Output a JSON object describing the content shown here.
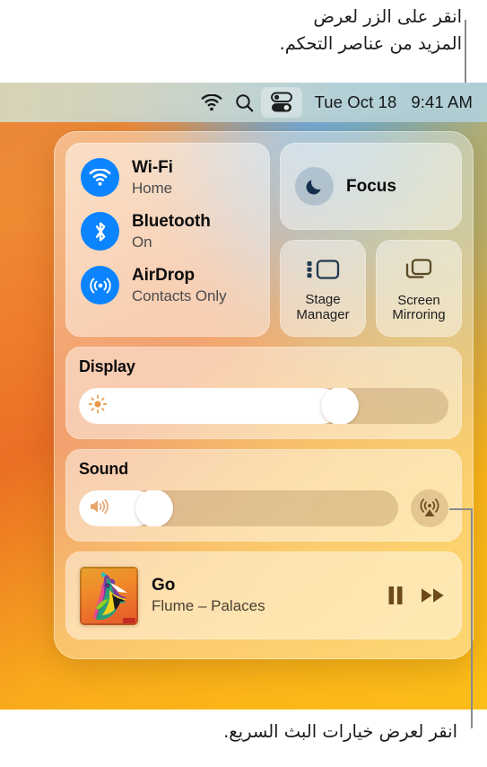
{
  "annotations": {
    "top": "انقر على الزر لعرض\nالمزيد من عناصر التحكم.",
    "bottom": "انقر لعرض خيارات البث السريع."
  },
  "menubar": {
    "wifi_icon": "wifi-icon",
    "search_icon": "search-icon",
    "control_center_icon": "control-center-icon",
    "date": "Tue Oct 18",
    "time": "9:41 AM"
  },
  "control_center": {
    "toggles": [
      {
        "icon": "wifi-icon",
        "title": "Wi-Fi",
        "subtitle": "Home"
      },
      {
        "icon": "bluetooth-icon",
        "title": "Bluetooth",
        "subtitle": "On"
      },
      {
        "icon": "airdrop-icon",
        "title": "AirDrop",
        "subtitle": "Contacts Only"
      }
    ],
    "focus": {
      "icon": "moon-icon",
      "label": "Focus"
    },
    "stage_manager": {
      "icon": "stage-manager-icon",
      "label": "Stage\nManager"
    },
    "screen_mirroring": {
      "icon": "screen-mirroring-icon",
      "label": "Screen\nMirroring"
    },
    "display": {
      "label": "Display",
      "icon": "brightness-icon",
      "value": 73
    },
    "sound": {
      "label": "Sound",
      "icon": "speaker-icon",
      "value": 20,
      "airplay_icon": "airplay-audio-icon"
    },
    "now_playing": {
      "title": "Go",
      "artist": "Flume – Palaces",
      "album_art": "bird-album-art",
      "pause_icon": "pause-icon",
      "forward_icon": "fast-forward-icon"
    }
  },
  "colors": {
    "accent_blue": "#0a84ff",
    "leader_line": "#8a8a8a",
    "text_primary": "#0c0c0d",
    "text_secondary": "#4b4b4e"
  }
}
